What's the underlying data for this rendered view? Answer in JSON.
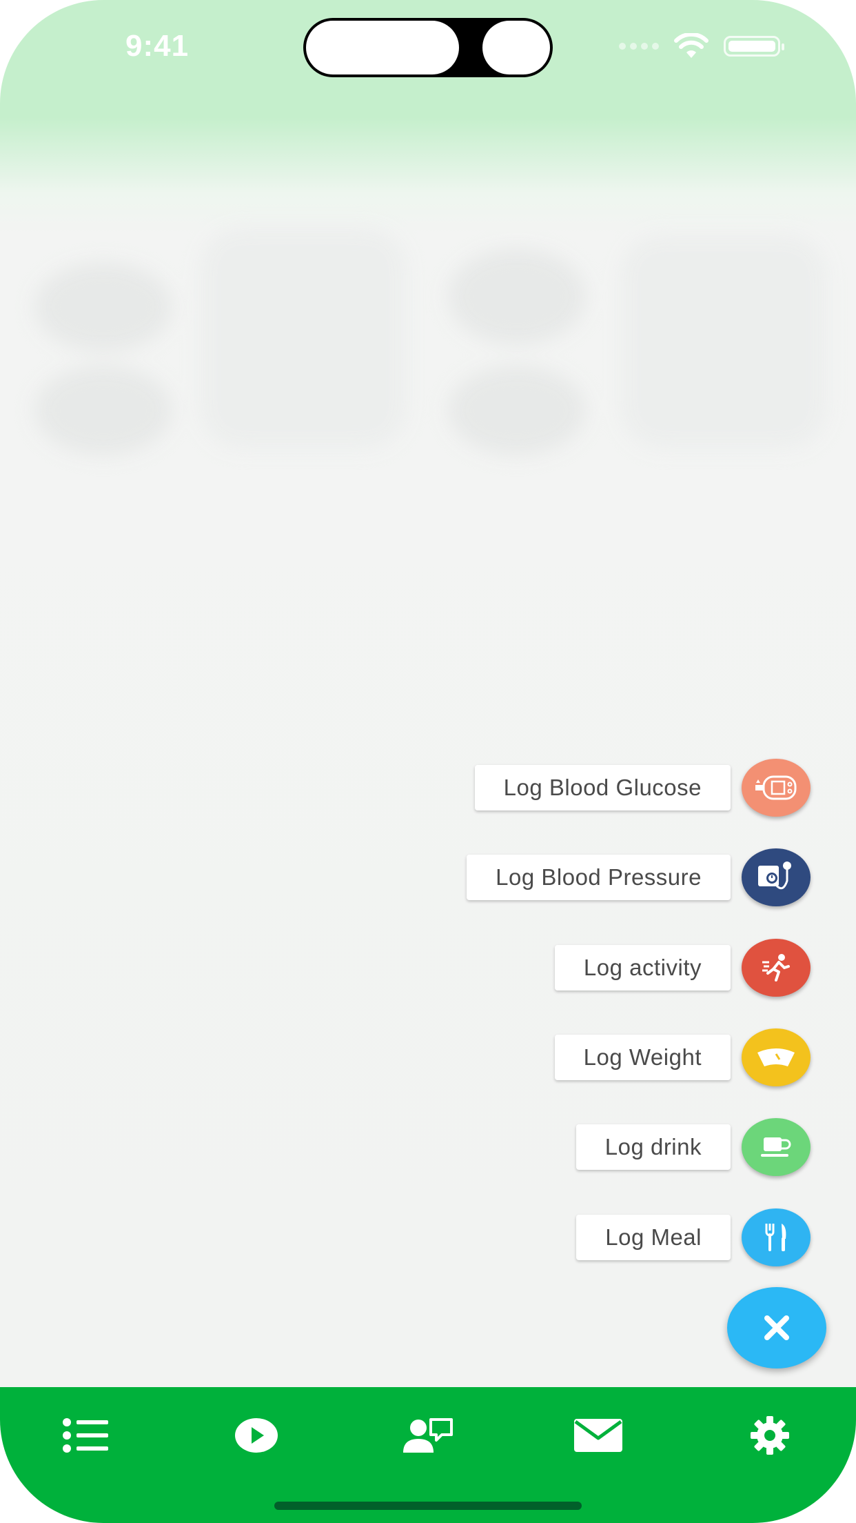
{
  "status_bar": {
    "time": "9:41"
  },
  "fab_menu": {
    "items": [
      {
        "label": "Log Blood Glucose",
        "icon": "glucose-meter-icon",
        "color": "#f39073"
      },
      {
        "label": "Log Blood Pressure",
        "icon": "blood-pressure-cuff-icon",
        "color": "#2f4a7f"
      },
      {
        "label": "Log activity",
        "icon": "running-person-icon",
        "color": "#e0523f"
      },
      {
        "label": "Log Weight",
        "icon": "scale-icon",
        "color": "#f3c21d"
      },
      {
        "label": "Log drink",
        "icon": "coffee-cup-icon",
        "color": "#6cd67a"
      },
      {
        "label": "Log Meal",
        "icon": "fork-knife-icon",
        "color": "#2fb4f2"
      }
    ],
    "close_icon": "close-icon",
    "close_color": "#2bb8f5"
  },
  "bottom_nav": {
    "color": "#00b13b",
    "items": [
      {
        "icon": "list-icon"
      },
      {
        "icon": "play-icon"
      },
      {
        "icon": "contact-chat-icon"
      },
      {
        "icon": "mail-icon"
      },
      {
        "icon": "gear-icon"
      }
    ]
  }
}
